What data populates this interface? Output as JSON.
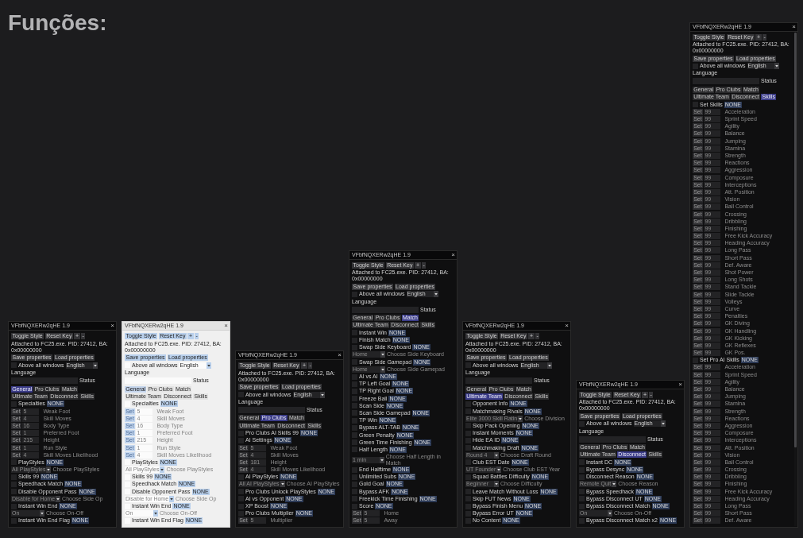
{
  "page": {
    "heading": "Funções:"
  },
  "windows": [
    {
      "kind": "dark",
      "title": "VFbfNQXERw2qHE 1.9",
      "close": "×",
      "toolbar": [
        "Toggle Style",
        "Reset Key",
        "+",
        "-"
      ],
      "attached": "Attached to FC25.exe. PID: 27412, BA: 0x00000000",
      "file_buttons": [
        "Save properties",
        "Load properties"
      ],
      "topmost": {
        "checked": false,
        "label": "Above all windows",
        "language": "English",
        "language_label": "Language"
      },
      "status": {
        "label": "Status"
      },
      "tabs": [
        {
          "label": "General",
          "selected": true
        },
        {
          "label": "Pro Clubs",
          "selected": false
        },
        {
          "label": "Match",
          "selected": false
        },
        {
          "label": "Ultimate Team",
          "selected": false
        },
        {
          "label": "Disconnect",
          "selected": false
        },
        {
          "label": "Skills",
          "selected": false
        }
      ],
      "rows": [
        {
          "kind": "toggle",
          "checked": false,
          "label": "Specialties",
          "hotkey": "NONE"
        },
        {
          "kind": "set",
          "button": "Set",
          "amount": "5",
          "caption": "Weak Foot"
        },
        {
          "kind": "set",
          "button": "Set",
          "amount": "4",
          "caption": "Skill Moves"
        },
        {
          "kind": "set",
          "button": "Set",
          "amount": "16",
          "caption": "Body Type"
        },
        {
          "kind": "set",
          "button": "Set",
          "amount": "1",
          "caption": "Preferred Foot"
        },
        {
          "kind": "set",
          "button": "Set",
          "amount": "215",
          "caption": "Height"
        },
        {
          "kind": "set",
          "button": "Set",
          "amount": "1",
          "caption": "Run Style"
        },
        {
          "kind": "set",
          "button": "Set",
          "amount": "4",
          "caption": "Skill Moves Likelihood"
        },
        {
          "kind": "toggle",
          "checked": false,
          "label": "PlayStyles",
          "hotkey": "NONE"
        },
        {
          "kind": "combo",
          "option": "All PlayStyles",
          "caption": "Choose PlayStyles"
        },
        {
          "kind": "toggle",
          "checked": false,
          "label": "Skills 99",
          "hotkey": "NONE"
        },
        {
          "kind": "toggle",
          "checked": false,
          "label": "Speedhack Match",
          "hotkey": "NONE"
        },
        {
          "kind": "toggle",
          "checked": false,
          "label": "Disable Opponent Pass",
          "hotkey": "NONE"
        },
        {
          "kind": "combo",
          "option": "Disable for Home",
          "caption": "Choose Side Op"
        },
        {
          "kind": "toggle",
          "checked": false,
          "label": "Instant Win End",
          "hotkey": "NONE"
        },
        {
          "kind": "combo",
          "option": "On",
          "caption": "Choose On-Off"
        },
        {
          "kind": "toggle",
          "checked": false,
          "label": "Instant Win End Flag",
          "hotkey": "NONE"
        }
      ]
    },
    {
      "kind": "light",
      "title": "VFbfNQXERw2qHE 1.9",
      "close": "×",
      "toolbar": [
        "Toggle Style",
        "Reset Key",
        "+",
        "-"
      ],
      "attached": "Attached to FC25.exe. PID: 27412, BA: 0x00000000",
      "file_buttons": [
        "Save properties",
        "Load properties"
      ],
      "topmost": {
        "checked": false,
        "label": "Above all windows",
        "language": "English",
        "language_label": "Language"
      },
      "status": {
        "label": "Status"
      },
      "tabs": [
        {
          "label": "General",
          "selected": true
        },
        {
          "label": "Pro Clubs",
          "selected": false
        },
        {
          "label": "Match",
          "selected": false
        },
        {
          "label": "Ultimate Team",
          "selected": false
        },
        {
          "label": "Disconnect",
          "selected": false
        },
        {
          "label": "Skills",
          "selected": false
        }
      ],
      "rows": [
        {
          "kind": "toggle",
          "checked": false,
          "label": "Specialties",
          "hotkey": "NONE"
        },
        {
          "kind": "set",
          "button": "Set",
          "amount": "5",
          "caption": "Weak Foot"
        },
        {
          "kind": "set",
          "button": "Set",
          "amount": "4",
          "caption": "Skill Moves"
        },
        {
          "kind": "set",
          "button": "Set",
          "amount": "16",
          "caption": "Body Type"
        },
        {
          "kind": "set",
          "button": "Set",
          "amount": "1",
          "caption": "Preferred Foot"
        },
        {
          "kind": "set",
          "button": "Set",
          "amount": "215",
          "caption": "Height"
        },
        {
          "kind": "set",
          "button": "Set",
          "amount": "1",
          "caption": "Run Style"
        },
        {
          "kind": "set",
          "button": "Set",
          "amount": "4",
          "caption": "Skill Moves Likelihood"
        },
        {
          "kind": "toggle",
          "checked": false,
          "label": "PlayStyles",
          "hotkey": "NONE"
        },
        {
          "kind": "combo",
          "option": "All PlayStyles",
          "caption": "Choose PlayStyles"
        },
        {
          "kind": "toggle",
          "checked": false,
          "label": "Skills 99",
          "hotkey": "NONE"
        },
        {
          "kind": "toggle",
          "checked": false,
          "label": "Speedhack Match",
          "hotkey": "NONE"
        },
        {
          "kind": "toggle",
          "checked": false,
          "label": "Disable Opponent Pass",
          "hotkey": "NONE"
        },
        {
          "kind": "combo",
          "option": "Disable for Home",
          "caption": "Choose Side Op"
        },
        {
          "kind": "toggle",
          "checked": false,
          "label": "Instant Win End",
          "hotkey": "NONE"
        },
        {
          "kind": "combo",
          "option": "On",
          "caption": "Choose On-Off"
        },
        {
          "kind": "toggle",
          "checked": false,
          "label": "Instant Win End Flag",
          "hotkey": "NONE"
        }
      ]
    },
    {
      "kind": "dark",
      "title": "VFbfNQXERw2qHE 1.9",
      "close": "×",
      "toolbar": [
        "Toggle Style",
        "Reset Key",
        "+",
        "-"
      ],
      "attached": "Attached to FC25.exe. PID: 27412, BA: 0x00000000",
      "file_buttons": [
        "Save properties",
        "Load properties"
      ],
      "topmost": {
        "checked": false,
        "label": "Above all windows",
        "language": "English",
        "language_label": "Language"
      },
      "status": {
        "label": "Status"
      },
      "tabs": [
        {
          "label": "General",
          "selected": false
        },
        {
          "label": "Pro Clubs",
          "selected": true
        },
        {
          "label": "Match",
          "selected": false
        },
        {
          "label": "Ultimate Team",
          "selected": false
        },
        {
          "label": "Disconnect",
          "selected": false
        },
        {
          "label": "Skills",
          "selected": false
        }
      ],
      "rows": [
        {
          "kind": "toggle",
          "checked": false,
          "label": "Pro Clubs AI Skills 99",
          "hotkey": "NONE"
        },
        {
          "kind": "toggle",
          "checked": false,
          "label": "AI Settings",
          "hotkey": "NONE"
        },
        {
          "kind": "set",
          "button": "Set",
          "amount": "5",
          "caption": "Weak Foot"
        },
        {
          "kind": "set",
          "button": "Set",
          "amount": "4",
          "caption": "Skill Moves"
        },
        {
          "kind": "set",
          "button": "Set",
          "amount": "181",
          "caption": "Height"
        },
        {
          "kind": "set",
          "button": "Set",
          "amount": "4",
          "caption": "Skill Moves Likelihood"
        },
        {
          "kind": "toggle",
          "checked": false,
          "label": "AI PlayStyles",
          "hotkey": "NONE"
        },
        {
          "kind": "combo",
          "option": "All AI PlayStyles",
          "caption": "Choose AI PlayStyles"
        },
        {
          "kind": "toggle",
          "checked": false,
          "label": "Pro Clubs Unlock PlayStyles",
          "hotkey": "NONE"
        },
        {
          "kind": "toggle",
          "checked": false,
          "label": "AI vs Opponent",
          "hotkey": "NONE"
        },
        {
          "kind": "toggle",
          "checked": false,
          "label": "XP Boost",
          "hotkey": "NONE"
        },
        {
          "kind": "toggle",
          "checked": false,
          "label": "Pro Clubs Multiplier",
          "hotkey": "NONE"
        },
        {
          "kind": "set",
          "button": "Set",
          "amount": "5",
          "caption": "Multiplier"
        }
      ]
    },
    {
      "kind": "dark",
      "title": "VFbfNQXERw2qHE 1.9",
      "close": "×",
      "toolbar": [
        "Toggle Style",
        "Reset Key",
        "+",
        "-"
      ],
      "attached": "Attached to FC25.exe. PID: 27412, BA: 0x00000000",
      "file_buttons": [
        "Save properties",
        "Load properties"
      ],
      "topmost": {
        "checked": false,
        "label": "Above all windows",
        "language": "English",
        "language_label": "Language"
      },
      "status": {
        "label": "Status"
      },
      "tabs": [
        {
          "label": "General",
          "selected": false
        },
        {
          "label": "Pro Clubs",
          "selected": false
        },
        {
          "label": "Match",
          "selected": true
        },
        {
          "label": "Ultimate Team",
          "selected": false
        },
        {
          "label": "Disconnect",
          "selected": false
        },
        {
          "label": "Skills",
          "selected": false
        }
      ],
      "rows": [
        {
          "kind": "toggle",
          "checked": false,
          "label": "Instant Win",
          "hotkey": "NONE"
        },
        {
          "kind": "toggle",
          "checked": false,
          "label": "Finish Match",
          "hotkey": "NONE"
        },
        {
          "kind": "toggle",
          "checked": false,
          "label": "Swap Side Keyboard",
          "hotkey": "NONE"
        },
        {
          "kind": "combo",
          "option": "Home",
          "caption": "Choose Side Keyboard"
        },
        {
          "kind": "toggle",
          "checked": false,
          "label": "Swap Side Gamepad",
          "hotkey": "NONE"
        },
        {
          "kind": "combo",
          "option": "Home",
          "caption": "Choose Side Gamepad"
        },
        {
          "kind": "toggle",
          "checked": false,
          "label": "AI vs AI",
          "hotkey": "NONE"
        },
        {
          "kind": "toggle",
          "checked": false,
          "label": "TP Left Goal",
          "hotkey": "NONE"
        },
        {
          "kind": "toggle",
          "checked": false,
          "label": "TP Right Goal",
          "hotkey": "NONE"
        },
        {
          "kind": "toggle",
          "checked": false,
          "label": "Freeze Ball",
          "hotkey": "NONE"
        },
        {
          "kind": "toggle",
          "checked": false,
          "label": "Scan Side",
          "hotkey": "NONE"
        },
        {
          "kind": "toggle",
          "checked": false,
          "label": "Scan Side Gamepad",
          "hotkey": "NONE"
        },
        {
          "kind": "toggle",
          "checked": false,
          "label": "TP Win",
          "hotkey": "NONE"
        },
        {
          "kind": "toggle",
          "checked": false,
          "label": "Bypass ALT-TAB",
          "hotkey": "NONE"
        },
        {
          "kind": "toggle",
          "checked": false,
          "label": "Green Penalty",
          "hotkey": "NONE"
        },
        {
          "kind": "toggle",
          "checked": false,
          "label": "Green Time Finishing",
          "hotkey": "NONE"
        },
        {
          "kind": "toggle",
          "checked": false,
          "label": "Half Length",
          "hotkey": "NONE"
        },
        {
          "kind": "combo",
          "option": "1 min",
          "caption": "Choose Half Length in Match"
        },
        {
          "kind": "toggle",
          "checked": false,
          "label": "End Halftime",
          "hotkey": "NONE"
        },
        {
          "kind": "toggle",
          "checked": false,
          "label": "Unlimited Subs",
          "hotkey": "NONE"
        },
        {
          "kind": "toggle",
          "checked": false,
          "label": "Gold Goal",
          "hotkey": "NONE"
        },
        {
          "kind": "toggle",
          "checked": false,
          "label": "Bypass AFK",
          "hotkey": "NONE"
        },
        {
          "kind": "toggle",
          "checked": false,
          "label": "Freekick Time Finishing",
          "hotkey": "NONE"
        },
        {
          "kind": "toggle",
          "checked": false,
          "label": "Score",
          "hotkey": "NONE"
        },
        {
          "kind": "set",
          "button": "Set",
          "amount": "5",
          "caption": "Home"
        },
        {
          "kind": "set",
          "button": "Set",
          "amount": "5",
          "caption": "Away"
        }
      ]
    },
    {
      "kind": "dark",
      "title": "VFbfNQXERw2qHE 1.9",
      "close": "×",
      "toolbar": [
        "Toggle Style",
        "Reset Key",
        "+",
        "-"
      ],
      "attached": "Attached to FC25.exe. PID: 27412, BA: 0x00000000",
      "file_buttons": [
        "Save properties",
        "Load properties"
      ],
      "topmost": {
        "checked": false,
        "label": "Above all windows",
        "language": "English",
        "language_label": "Language"
      },
      "status": {
        "label": "Status"
      },
      "tabs": [
        {
          "label": "General",
          "selected": false
        },
        {
          "label": "Pro Clubs",
          "selected": false
        },
        {
          "label": "Match",
          "selected": false
        },
        {
          "label": "Ultimate Team",
          "selected": true
        },
        {
          "label": "Disconnect",
          "selected": false
        },
        {
          "label": "Skills",
          "selected": false
        }
      ],
      "rows": [
        {
          "kind": "toggle",
          "checked": false,
          "label": "Opponent Info",
          "hotkey": "NONE"
        },
        {
          "kind": "toggle",
          "checked": false,
          "label": "Matchmaking Rivals",
          "hotkey": "NONE"
        },
        {
          "kind": "combo",
          "option": "Elite 3000 Skill Ratin",
          "caption": "Choose Division"
        },
        {
          "kind": "toggle",
          "checked": false,
          "label": "Skip Pack Opening",
          "hotkey": "NONE"
        },
        {
          "kind": "toggle",
          "checked": false,
          "label": "Instant Moments",
          "hotkey": "NONE"
        },
        {
          "kind": "toggle",
          "checked": false,
          "label": "Hide EA ID",
          "hotkey": "NONE"
        },
        {
          "kind": "toggle",
          "checked": false,
          "label": "Matchmaking Draft",
          "hotkey": "NONE"
        },
        {
          "kind": "combo",
          "option": "Round 4",
          "caption": "Choose Draft Round"
        },
        {
          "kind": "toggle",
          "checked": false,
          "label": "Club EST Date",
          "hotkey": "NONE"
        },
        {
          "kind": "combo",
          "option": "UT Founder",
          "caption": "Choose Club EST Year"
        },
        {
          "kind": "toggle",
          "checked": false,
          "label": "Squad Battles Difficulty",
          "hotkey": "NONE"
        },
        {
          "kind": "combo",
          "option": "Beginner",
          "caption": "Choose Difficulty"
        },
        {
          "kind": "toggle",
          "checked": false,
          "label": "Leave Match Without Loss",
          "hotkey": "NONE"
        },
        {
          "kind": "toggle",
          "checked": false,
          "label": "Skip FUT News",
          "hotkey": "NONE"
        },
        {
          "kind": "toggle",
          "checked": false,
          "label": "Bypass Finish Menu",
          "hotkey": "NONE"
        },
        {
          "kind": "toggle",
          "checked": false,
          "label": "Bypass Error UT",
          "hotkey": "NONE"
        },
        {
          "kind": "toggle",
          "checked": false,
          "label": "No Content",
          "hotkey": "NONE"
        }
      ]
    },
    {
      "kind": "dark",
      "title": "VFbfNQXERw2qHE 1.9",
      "close": "×",
      "toolbar": [
        "Toggle Style",
        "Reset Key",
        "+",
        "-"
      ],
      "attached": "Attached to FC25.exe. PID: 27412, BA: 0x00000000",
      "file_buttons": [
        "Save properties",
        "Load properties"
      ],
      "topmost": {
        "checked": false,
        "label": "Above all windows",
        "language": "English",
        "language_label": "Language"
      },
      "status": {
        "label": "Status"
      },
      "tabs": [
        {
          "label": "General",
          "selected": false
        },
        {
          "label": "Pro Clubs",
          "selected": false
        },
        {
          "label": "Match",
          "selected": false
        },
        {
          "label": "Ultimate Team",
          "selected": false
        },
        {
          "label": "Disconnect",
          "selected": true
        },
        {
          "label": "Skills",
          "selected": false
        }
      ],
      "rows": [
        {
          "kind": "toggle",
          "checked": false,
          "label": "Instant DC",
          "hotkey": "NONE"
        },
        {
          "kind": "toggle",
          "checked": false,
          "label": "Bypass Desync",
          "hotkey": "NONE"
        },
        {
          "kind": "toggle",
          "checked": false,
          "label": "Disconnect Reason",
          "hotkey": "NONE"
        },
        {
          "kind": "combo",
          "option": "Remote Quit",
          "caption": "Choose Reason"
        },
        {
          "kind": "toggle",
          "checked": false,
          "label": "Bypass Speedhack",
          "hotkey": "NONE"
        },
        {
          "kind": "toggle",
          "checked": false,
          "label": "Bypass Disconnect UT",
          "hotkey": "NONE"
        },
        {
          "kind": "toggle",
          "checked": false,
          "label": "Bypass Disconnect Match",
          "hotkey": "NONE"
        },
        {
          "kind": "combo",
          "option": "On",
          "caption": "Choose On-Off"
        },
        {
          "kind": "toggle",
          "checked": false,
          "label": "Bypass Disconnect Match x2",
          "hotkey": "NONE"
        }
      ]
    },
    {
      "kind": "dark",
      "title": "VFbfNQXERw2qHE 1.9",
      "close": "×",
      "scrollbar": true,
      "toolbar": [
        "Toggle Style",
        "Reset Key",
        "+",
        "-"
      ],
      "attached": "Attached to FC25.exe. PID: 27412, BA: 0x00000000",
      "file_buttons": [
        "Save properties",
        "Load properties"
      ],
      "topmost": {
        "checked": false,
        "label": "Above all windows",
        "language": "English",
        "language_label": "Language"
      },
      "status": {
        "label": "Status"
      },
      "tabs": [
        {
          "label": "General",
          "selected": false
        },
        {
          "label": "Pro Clubs",
          "selected": false
        },
        {
          "label": "Match",
          "selected": false
        },
        {
          "label": "Ultimate Team",
          "selected": false
        },
        {
          "label": "Disconnect",
          "selected": false
        },
        {
          "label": "Skills",
          "selected": true
        }
      ],
      "rows": [
        {
          "kind": "toggle",
          "checked": false,
          "label": "Set Skills",
          "hotkey": "NONE"
        },
        {
          "kind": "set",
          "button": "Set",
          "amount": "99",
          "caption": "Acceleration"
        },
        {
          "kind": "set",
          "button": "Set",
          "amount": "99",
          "caption": "Sprint Speed"
        },
        {
          "kind": "set",
          "button": "Set",
          "amount": "99",
          "caption": "Agility"
        },
        {
          "kind": "set",
          "button": "Set",
          "amount": "99",
          "caption": "Balance"
        },
        {
          "kind": "set",
          "button": "Set",
          "amount": "99",
          "caption": "Jumping"
        },
        {
          "kind": "set",
          "button": "Set",
          "amount": "99",
          "caption": "Stamina"
        },
        {
          "kind": "set",
          "button": "Set",
          "amount": "99",
          "caption": "Strength"
        },
        {
          "kind": "set",
          "button": "Set",
          "amount": "99",
          "caption": "Reactions"
        },
        {
          "kind": "set",
          "button": "Set",
          "amount": "99",
          "caption": "Aggression"
        },
        {
          "kind": "set",
          "button": "Set",
          "amount": "99",
          "caption": "Composure"
        },
        {
          "kind": "set",
          "button": "Set",
          "amount": "99",
          "caption": "Interceptions"
        },
        {
          "kind": "set",
          "button": "Set",
          "amount": "99",
          "caption": "Att. Position"
        },
        {
          "kind": "set",
          "button": "Set",
          "amount": "99",
          "caption": "Vision"
        },
        {
          "kind": "set",
          "button": "Set",
          "amount": "99",
          "caption": "Ball Control"
        },
        {
          "kind": "set",
          "button": "Set",
          "amount": "99",
          "caption": "Crossing"
        },
        {
          "kind": "set",
          "button": "Set",
          "amount": "99",
          "caption": "Dribbling"
        },
        {
          "kind": "set",
          "button": "Set",
          "amount": "99",
          "caption": "Finishing"
        },
        {
          "kind": "set",
          "button": "Set",
          "amount": "99",
          "caption": "Free Kick Accuracy"
        },
        {
          "kind": "set",
          "button": "Set",
          "amount": "99",
          "caption": "Heading Accuracy"
        },
        {
          "kind": "set",
          "button": "Set",
          "amount": "99",
          "caption": "Long Pass"
        },
        {
          "kind": "set",
          "button": "Set",
          "amount": "99",
          "caption": "Short Pass"
        },
        {
          "kind": "set",
          "button": "Set",
          "amount": "99",
          "caption": "Def. Aware"
        },
        {
          "kind": "set",
          "button": "Set",
          "amount": "99",
          "caption": "Shot Power"
        },
        {
          "kind": "set",
          "button": "Set",
          "amount": "99",
          "caption": "Long Shots"
        },
        {
          "kind": "set",
          "button": "Set",
          "amount": "99",
          "caption": "Stand Tackle"
        },
        {
          "kind": "set",
          "button": "Set",
          "amount": "99",
          "caption": "Slide Tackle"
        },
        {
          "kind": "set",
          "button": "Set",
          "amount": "99",
          "caption": "Volleys"
        },
        {
          "kind": "set",
          "button": "Set",
          "amount": "99",
          "caption": "Curve"
        },
        {
          "kind": "set",
          "button": "Set",
          "amount": "99",
          "caption": "Penalties"
        },
        {
          "kind": "set",
          "button": "Set",
          "amount": "99",
          "caption": "GK Diving"
        },
        {
          "kind": "set",
          "button": "Set",
          "amount": "99",
          "caption": "GK Handling"
        },
        {
          "kind": "set",
          "button": "Set",
          "amount": "99",
          "caption": "GK Kicking"
        },
        {
          "kind": "set",
          "button": "Set",
          "amount": "99",
          "caption": "GK Reflexes"
        },
        {
          "kind": "set",
          "button": "Set",
          "amount": "99",
          "caption": "GK Pos."
        },
        {
          "kind": "toggle",
          "checked": false,
          "label": "Set Pro AI Skills",
          "hotkey": "NONE"
        },
        {
          "kind": "set",
          "button": "Set",
          "amount": "99",
          "caption": "Acceleration"
        },
        {
          "kind": "set",
          "button": "Set",
          "amount": "99",
          "caption": "Sprint Speed"
        },
        {
          "kind": "set",
          "button": "Set",
          "amount": "99",
          "caption": "Agility"
        },
        {
          "kind": "set",
          "button": "Set",
          "amount": "99",
          "caption": "Balance"
        },
        {
          "kind": "set",
          "button": "Set",
          "amount": "99",
          "caption": "Jumping"
        },
        {
          "kind": "set",
          "button": "Set",
          "amount": "99",
          "caption": "Stamina"
        },
        {
          "kind": "set",
          "button": "Set",
          "amount": "99",
          "caption": "Strength"
        },
        {
          "kind": "set",
          "button": "Set",
          "amount": "99",
          "caption": "Reactions"
        },
        {
          "kind": "set",
          "button": "Set",
          "amount": "99",
          "caption": "Aggression"
        },
        {
          "kind": "set",
          "button": "Set",
          "amount": "99",
          "caption": "Composure"
        },
        {
          "kind": "set",
          "button": "Set",
          "amount": "99",
          "caption": "Interceptions"
        },
        {
          "kind": "set",
          "button": "Set",
          "amount": "99",
          "caption": "Att. Position"
        },
        {
          "kind": "set",
          "button": "Set",
          "amount": "99",
          "caption": "Vision"
        },
        {
          "kind": "set",
          "button": "Set",
          "amount": "99",
          "caption": "Ball Control"
        },
        {
          "kind": "set",
          "button": "Set",
          "amount": "99",
          "caption": "Crossing"
        },
        {
          "kind": "set",
          "button": "Set",
          "amount": "99",
          "caption": "Dribbling"
        },
        {
          "kind": "set",
          "button": "Set",
          "amount": "99",
          "caption": "Finishing"
        },
        {
          "kind": "set",
          "button": "Set",
          "amount": "99",
          "caption": "Free Kick Accuracy"
        },
        {
          "kind": "set",
          "button": "Set",
          "amount": "99",
          "caption": "Heading Accuracy"
        },
        {
          "kind": "set",
          "button": "Set",
          "amount": "99",
          "caption": "Long Pass"
        },
        {
          "kind": "set",
          "button": "Set",
          "amount": "99",
          "caption": "Short Pass"
        },
        {
          "kind": "set",
          "button": "Set",
          "amount": "99",
          "caption": "Def. Aware"
        }
      ]
    }
  ]
}
